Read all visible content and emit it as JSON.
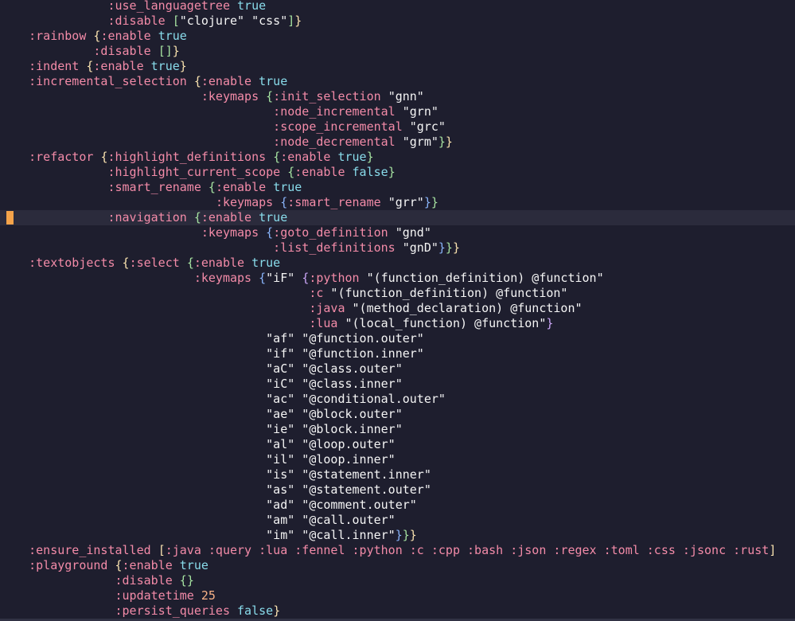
{
  "colors": {
    "background": "#1e1e2e",
    "keyword": "#f38ba8",
    "boolean": "#89dceb",
    "string": "#f5f5f5",
    "bracket_level_1": "#f9e2af",
    "bracket_level_2": "#a6e3a1",
    "bracket_level_3": "#89b4fa",
    "bracket_level_4": "#cba6f7",
    "number": "#fab387",
    "cursor_marker": "#f5a34a",
    "current_line": "#2b2b3c"
  },
  "current_line_index": 14,
  "lines": [
    [
      [
        "",
        "               "
      ],
      [
        "kw",
        ":use_languagetree"
      ],
      [
        "",
        " "
      ],
      [
        "bool",
        "true"
      ]
    ],
    [
      [
        "",
        "               "
      ],
      [
        "kw",
        ":disable"
      ],
      [
        "",
        " "
      ],
      [
        "b2",
        "["
      ],
      [
        "str",
        "\"clojure\""
      ],
      [
        "",
        " "
      ],
      [
        "str",
        "\"css\""
      ],
      [
        "b2",
        "]"
      ],
      [
        "b1",
        "}"
      ]
    ],
    [
      [
        "",
        "    "
      ],
      [
        "kw",
        ":rainbow"
      ],
      [
        "",
        " "
      ],
      [
        "b1",
        "{"
      ],
      [
        "kw",
        ":enable"
      ],
      [
        "",
        " "
      ],
      [
        "bool",
        "true"
      ]
    ],
    [
      [
        "",
        "             "
      ],
      [
        "kw",
        ":disable"
      ],
      [
        "",
        " "
      ],
      [
        "b2",
        "["
      ],
      [
        "b2",
        "]"
      ],
      [
        "b1",
        "}"
      ]
    ],
    [
      [
        "",
        "    "
      ],
      [
        "kw",
        ":indent"
      ],
      [
        "",
        " "
      ],
      [
        "b1",
        "{"
      ],
      [
        "kw",
        ":enable"
      ],
      [
        "",
        " "
      ],
      [
        "bool",
        "true"
      ],
      [
        "b1",
        "}"
      ]
    ],
    [
      [
        "",
        "    "
      ],
      [
        "kw",
        ":incremental_selection"
      ],
      [
        "",
        " "
      ],
      [
        "b1",
        "{"
      ],
      [
        "kw",
        ":enable"
      ],
      [
        "",
        " "
      ],
      [
        "bool",
        "true"
      ]
    ],
    [
      [
        "",
        "                            "
      ],
      [
        "kw",
        ":keymaps"
      ],
      [
        "",
        " "
      ],
      [
        "b2",
        "{"
      ],
      [
        "kw",
        ":init_selection"
      ],
      [
        "",
        " "
      ],
      [
        "str",
        "\"gnn\""
      ]
    ],
    [
      [
        "",
        "                                      "
      ],
      [
        "kw",
        ":node_incremental"
      ],
      [
        "",
        " "
      ],
      [
        "str",
        "\"grn\""
      ]
    ],
    [
      [
        "",
        "                                      "
      ],
      [
        "kw",
        ":scope_incremental"
      ],
      [
        "",
        " "
      ],
      [
        "str",
        "\"grc\""
      ]
    ],
    [
      [
        "",
        "                                      "
      ],
      [
        "kw",
        ":node_decremental"
      ],
      [
        "",
        " "
      ],
      [
        "str",
        "\"grm\""
      ],
      [
        "b2",
        "}"
      ],
      [
        "b1",
        "}"
      ]
    ],
    [
      [
        "",
        "    "
      ],
      [
        "kw",
        ":refactor"
      ],
      [
        "",
        " "
      ],
      [
        "b1",
        "{"
      ],
      [
        "kw",
        ":highlight_definitions"
      ],
      [
        "",
        " "
      ],
      [
        "b2",
        "{"
      ],
      [
        "kw",
        ":enable"
      ],
      [
        "",
        " "
      ],
      [
        "bool",
        "true"
      ],
      [
        "b2",
        "}"
      ]
    ],
    [
      [
        "",
        "               "
      ],
      [
        "kw",
        ":highlight_current_scope"
      ],
      [
        "",
        " "
      ],
      [
        "b2",
        "{"
      ],
      [
        "kw",
        ":enable"
      ],
      [
        "",
        " "
      ],
      [
        "bool",
        "false"
      ],
      [
        "b2",
        "}"
      ]
    ],
    [
      [
        "",
        "               "
      ],
      [
        "kw",
        ":smart_rename"
      ],
      [
        "",
        " "
      ],
      [
        "b2",
        "{"
      ],
      [
        "kw",
        ":enable"
      ],
      [
        "",
        " "
      ],
      [
        "bool",
        "true"
      ]
    ],
    [
      [
        "",
        "                              "
      ],
      [
        "kw",
        ":keymaps"
      ],
      [
        "",
        " "
      ],
      [
        "b3",
        "{"
      ],
      [
        "kw",
        ":smart_rename"
      ],
      [
        "",
        " "
      ],
      [
        "str",
        "\"grr\""
      ],
      [
        "b3",
        "}"
      ],
      [
        "b2",
        "}"
      ]
    ],
    [
      [
        "",
        "               "
      ],
      [
        "kw",
        ":navigation"
      ],
      [
        "",
        " "
      ],
      [
        "b2",
        "{"
      ],
      [
        "kw",
        ":enable"
      ],
      [
        "",
        " "
      ],
      [
        "bool",
        "true"
      ]
    ],
    [
      [
        "",
        "                            "
      ],
      [
        "kw",
        ":keymaps"
      ],
      [
        "",
        " "
      ],
      [
        "b3",
        "{"
      ],
      [
        "kw",
        ":goto_definition"
      ],
      [
        "",
        " "
      ],
      [
        "str",
        "\"gnd\""
      ]
    ],
    [
      [
        "",
        "                                      "
      ],
      [
        "kw",
        ":list_definitions"
      ],
      [
        "",
        " "
      ],
      [
        "str",
        "\"gnD\""
      ],
      [
        "b3",
        "}"
      ],
      [
        "b2",
        "}"
      ],
      [
        "b1",
        "}"
      ]
    ],
    [
      [
        "",
        "    "
      ],
      [
        "kw",
        ":textobjects"
      ],
      [
        "",
        " "
      ],
      [
        "b1",
        "{"
      ],
      [
        "kw",
        ":select"
      ],
      [
        "",
        " "
      ],
      [
        "b2",
        "{"
      ],
      [
        "kw",
        ":enable"
      ],
      [
        "",
        " "
      ],
      [
        "bool",
        "true"
      ]
    ],
    [
      [
        "",
        "                           "
      ],
      [
        "kw",
        ":keymaps"
      ],
      [
        "",
        " "
      ],
      [
        "b3",
        "{"
      ],
      [
        "str",
        "\"iF\""
      ],
      [
        "",
        " "
      ],
      [
        "b4",
        "{"
      ],
      [
        "kw",
        ":python"
      ],
      [
        "",
        " "
      ],
      [
        "str",
        "\"(function_definition) @function\""
      ]
    ],
    [
      [
        "",
        "                                           "
      ],
      [
        "kw",
        ":c"
      ],
      [
        "",
        " "
      ],
      [
        "str",
        "\"(function_definition) @function\""
      ]
    ],
    [
      [
        "",
        "                                           "
      ],
      [
        "kw",
        ":java"
      ],
      [
        "",
        " "
      ],
      [
        "str",
        "\"(method_declaration) @function\""
      ]
    ],
    [
      [
        "",
        "                                           "
      ],
      [
        "kw",
        ":lua"
      ],
      [
        "",
        " "
      ],
      [
        "str",
        "\"(local_function) @function\""
      ],
      [
        "b4",
        "}"
      ]
    ],
    [
      [
        "",
        "                                     "
      ],
      [
        "str",
        "\"af\""
      ],
      [
        "",
        " "
      ],
      [
        "str",
        "\"@function.outer\""
      ]
    ],
    [
      [
        "",
        "                                     "
      ],
      [
        "str",
        "\"if\""
      ],
      [
        "",
        " "
      ],
      [
        "str",
        "\"@function.inner\""
      ]
    ],
    [
      [
        "",
        "                                     "
      ],
      [
        "str",
        "\"aC\""
      ],
      [
        "",
        " "
      ],
      [
        "str",
        "\"@class.outer\""
      ]
    ],
    [
      [
        "",
        "                                     "
      ],
      [
        "str",
        "\"iC\""
      ],
      [
        "",
        " "
      ],
      [
        "str",
        "\"@class.inner\""
      ]
    ],
    [
      [
        "",
        "                                     "
      ],
      [
        "str",
        "\"ac\""
      ],
      [
        "",
        " "
      ],
      [
        "str",
        "\"@conditional.outer\""
      ]
    ],
    [
      [
        "",
        "                                     "
      ],
      [
        "str",
        "\"ae\""
      ],
      [
        "",
        " "
      ],
      [
        "str",
        "\"@block.outer\""
      ]
    ],
    [
      [
        "",
        "                                     "
      ],
      [
        "str",
        "\"ie\""
      ],
      [
        "",
        " "
      ],
      [
        "str",
        "\"@block.inner\""
      ]
    ],
    [
      [
        "",
        "                                     "
      ],
      [
        "str",
        "\"al\""
      ],
      [
        "",
        " "
      ],
      [
        "str",
        "\"@loop.outer\""
      ]
    ],
    [
      [
        "",
        "                                     "
      ],
      [
        "str",
        "\"il\""
      ],
      [
        "",
        " "
      ],
      [
        "str",
        "\"@loop.inner\""
      ]
    ],
    [
      [
        "",
        "                                     "
      ],
      [
        "str",
        "\"is\""
      ],
      [
        "",
        " "
      ],
      [
        "str",
        "\"@statement.inner\""
      ]
    ],
    [
      [
        "",
        "                                     "
      ],
      [
        "str",
        "\"as\""
      ],
      [
        "",
        " "
      ],
      [
        "str",
        "\"@statement.outer\""
      ]
    ],
    [
      [
        "",
        "                                     "
      ],
      [
        "str",
        "\"ad\""
      ],
      [
        "",
        " "
      ],
      [
        "str",
        "\"@comment.outer\""
      ]
    ],
    [
      [
        "",
        "                                     "
      ],
      [
        "str",
        "\"am\""
      ],
      [
        "",
        " "
      ],
      [
        "str",
        "\"@call.outer\""
      ]
    ],
    [
      [
        "",
        "                                     "
      ],
      [
        "str",
        "\"im\""
      ],
      [
        "",
        " "
      ],
      [
        "str",
        "\"@call.inner\""
      ],
      [
        "b3",
        "}"
      ],
      [
        "b2",
        "}"
      ],
      [
        "b1",
        "}"
      ]
    ],
    [
      [
        "",
        "    "
      ],
      [
        "kw",
        ":ensure_installed"
      ],
      [
        "",
        " "
      ],
      [
        "b1",
        "["
      ],
      [
        "kw",
        ":java :query :lua :fennel :python :c :cpp :bash :json :regex :toml :css :jsonc :rust"
      ],
      [
        "b1",
        "]"
      ]
    ],
    [
      [
        "",
        "    "
      ],
      [
        "kw",
        ":playground"
      ],
      [
        "",
        " "
      ],
      [
        "b1",
        "{"
      ],
      [
        "kw",
        ":enable"
      ],
      [
        "",
        " "
      ],
      [
        "bool",
        "true"
      ]
    ],
    [
      [
        "",
        "                "
      ],
      [
        "kw",
        ":disable"
      ],
      [
        "",
        " "
      ],
      [
        "b2",
        "{"
      ],
      [
        "b2",
        "}"
      ]
    ],
    [
      [
        "",
        "                "
      ],
      [
        "kw",
        ":updatetime"
      ],
      [
        "",
        " "
      ],
      [
        "num",
        "25"
      ]
    ],
    [
      [
        "",
        "                "
      ],
      [
        "kw",
        ":persist_queries"
      ],
      [
        "",
        " "
      ],
      [
        "bool",
        "false"
      ],
      [
        "b1",
        "}"
      ]
    ]
  ]
}
